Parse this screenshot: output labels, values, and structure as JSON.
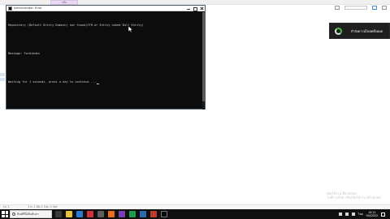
{
  "editor": {
    "tab_label": "แท็บ",
    "status_left": "Ln 1",
    "status_mid": "1 ln 1 Kb 1 Col: 1 Sel",
    "watermark_line1": "เปิดใช้งาน Windows",
    "watermark_line2": "ไปที่การตั้งค่าเพื่อเปิดใช้งาน Windows"
  },
  "console": {
    "title": "Administrator: Error",
    "lines": [
      "Repository (Default Entity Domain) not found(CFR-or Entity nuked Bull Entity)",
      "",
      "Message: Forbidden",
      "",
      "Waiting for 1 seconds, press a key to continue ..."
    ]
  },
  "toast": {
    "text": "กำลังดาวน์โหลดทั้งหมด"
  },
  "taskbar": {
    "search_text": "พิมพ์ที่นี่เพื่อค้นหา",
    "language": "ไทย",
    "time": "10:11",
    "date": "9/4/2022"
  },
  "colors": {
    "console_bg": "#0c0c0c",
    "console_text": "#cfcfcf",
    "taskbar_bg": "#101010",
    "toast_bg": "#1f1f1f",
    "toast_accent": "#3fbf3f",
    "editor_tab": "#e9d9f2"
  },
  "icons": [
    "windows-start-icon",
    "search-icon",
    "spinner-icon",
    "mouse-pointer-icon",
    "close-icon",
    "maximize-icon",
    "minimize-icon"
  ]
}
